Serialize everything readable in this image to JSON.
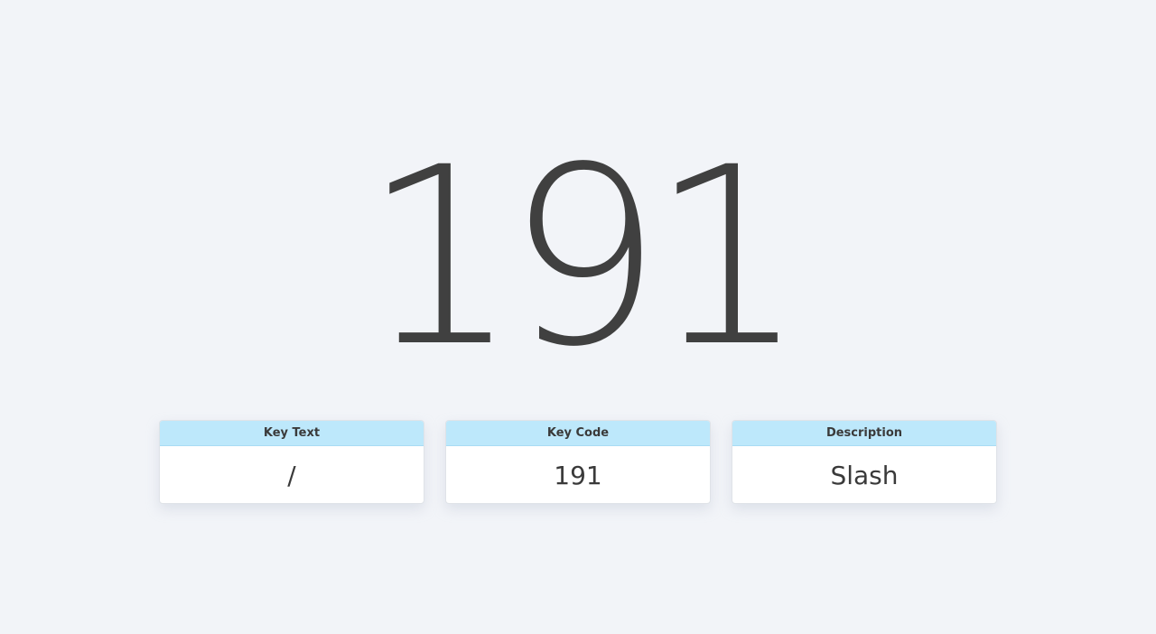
{
  "key_code_display": "191",
  "cards": [
    {
      "header": "Key Text",
      "value": "/"
    },
    {
      "header": "Key Code",
      "value": "191"
    },
    {
      "header": "Description",
      "value": "Slash"
    }
  ],
  "colors": {
    "background": "#f2f4f8",
    "card_header": "#bde8fb",
    "text": "#404040"
  }
}
